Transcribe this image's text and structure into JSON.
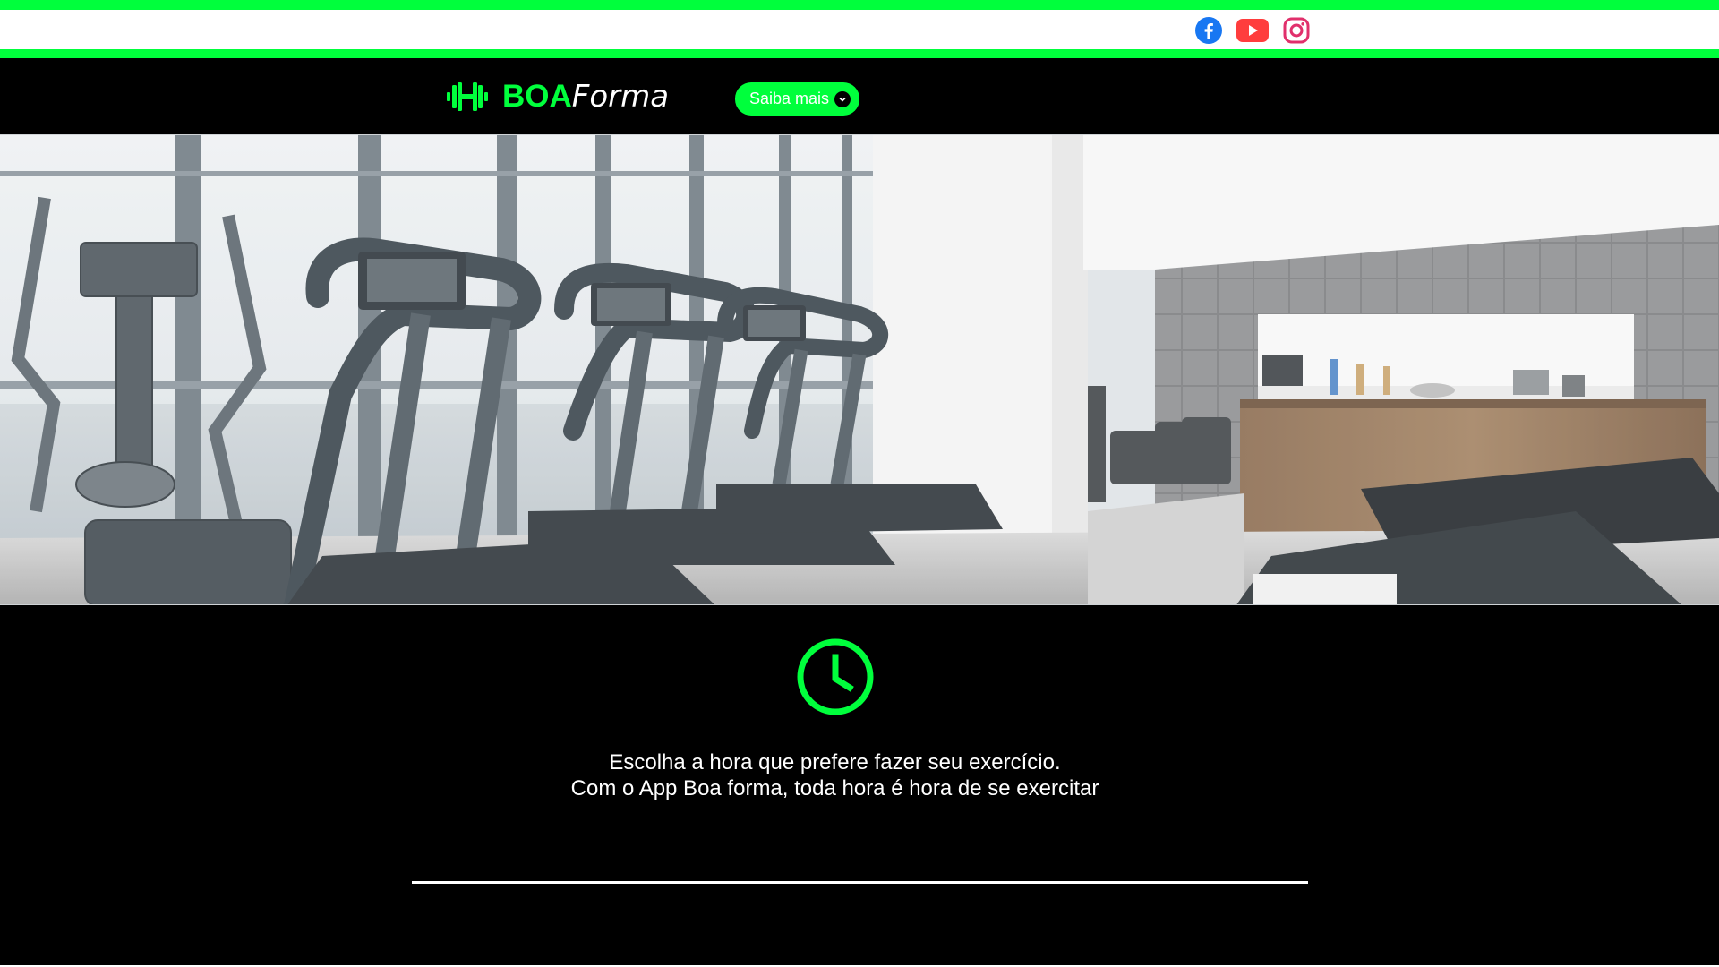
{
  "social": {
    "icons": [
      "facebook-icon",
      "youtube-icon",
      "instagram-icon"
    ],
    "colors": {
      "facebook": "#1877f2",
      "youtube": "#ff3d3d",
      "instagram": "#e1306c"
    }
  },
  "header": {
    "logo_bold": "BOA",
    "logo_italic": "Forma",
    "logo_icon": "dumbbell-icon",
    "nav_button_label": "Saiba mais",
    "nav_button_icon": "chevron-down-icon"
  },
  "hero": {
    "image": "gym-treadmills-photo"
  },
  "feature": {
    "icon": "clock-icon",
    "line1": "Escolha a hora que prefere fazer seu exercício.",
    "line2": "Com o App Boa forma, toda hora é hora de se exercitar"
  },
  "colors": {
    "accent": "#00ff3c",
    "background": "#000000",
    "text": "#ffffff"
  }
}
